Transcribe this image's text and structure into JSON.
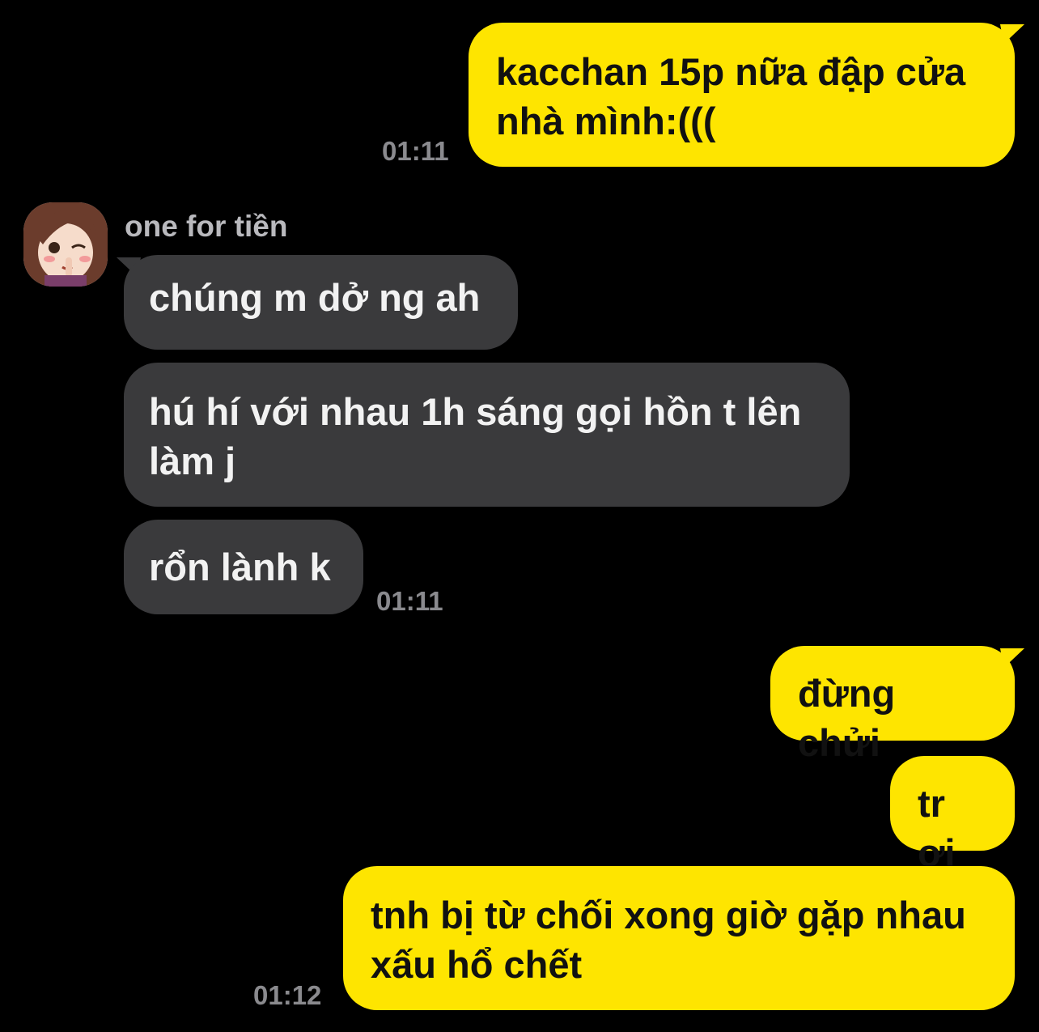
{
  "chat": {
    "partner_name": "one for tiền",
    "avatar_icon": "anime-girl-avatar-icon",
    "colors": {
      "background": "#000000",
      "outgoing_bubble": "#FEE500",
      "incoming_bubble": "#3A3A3C",
      "timestamp": "#8A8A8E"
    }
  },
  "messages": {
    "m1": {
      "text": "kacchan 15p nữa đập cửa\nnhà mình:(((",
      "time": "01:11",
      "direction": "outgoing"
    },
    "m2": {
      "text": "chúng m dở ng ah",
      "direction": "incoming"
    },
    "m3": {
      "text": "hú hí với nhau 1h sáng gọi hồn t lên\nlàm j",
      "direction": "incoming"
    },
    "m4": {
      "text": "rổn lành k",
      "time": "01:11",
      "direction": "incoming"
    },
    "m5": {
      "text": "đừng chửi",
      "direction": "outgoing"
    },
    "m6": {
      "text": "tr ơi",
      "direction": "outgoing"
    },
    "m7": {
      "text": "tnh bị từ chối xong giờ gặp nhau\nxấu hổ chết",
      "time": "01:12",
      "direction": "outgoing"
    }
  }
}
